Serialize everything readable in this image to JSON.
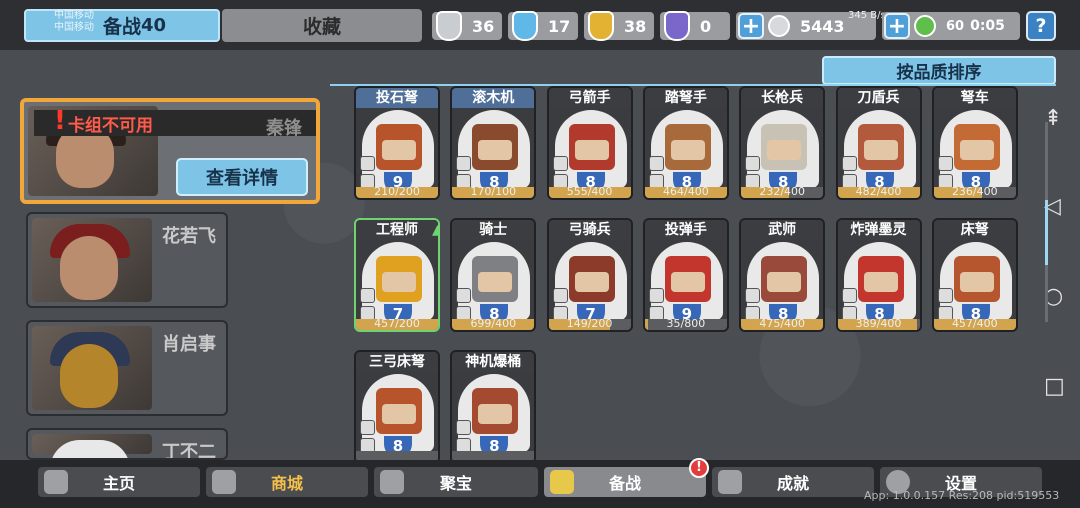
{
  "status_bar": {
    "carrier_line1": "中国移动",
    "carrier_line2": "中国移动",
    "network_speed": "345 B/s",
    "battery": "60",
    "time": "0:05"
  },
  "tabs": {
    "prepare_label": "备战",
    "prepare_count": "40",
    "collect_label": "收藏"
  },
  "resources": [
    {
      "name": "silver-shield-icon",
      "value": "36",
      "color": "#c9ccd1"
    },
    {
      "name": "blue-crystal-icon",
      "value": "17",
      "color": "#5fb8e8"
    },
    {
      "name": "gold-shield-icon",
      "value": "38",
      "color": "#e4b232"
    },
    {
      "name": "purple-shield-icon",
      "value": "0",
      "color": "#7b66c9"
    }
  ],
  "currency": {
    "value": "5443"
  },
  "sort_button": "按品质排序",
  "commanders": {
    "selected": {
      "warning": "卡组不可用",
      "name": "秦锋",
      "detail_button": "查看详情"
    },
    "list": [
      {
        "name": "花若飞"
      },
      {
        "name": "肖启事"
      },
      {
        "name": "丁不二"
      }
    ]
  },
  "units": [
    {
      "name": "投石弩",
      "level": "9",
      "progress": "210/200",
      "ratio": 1.0,
      "style": "blue",
      "color": "#b8542b"
    },
    {
      "name": "滚木机",
      "level": "8",
      "progress": "170/100",
      "ratio": 1.0,
      "style": "blue",
      "color": "#8a4a2e"
    },
    {
      "name": "弓箭手",
      "level": "8",
      "progress": "555/400",
      "ratio": 1.0,
      "style": "",
      "color": "#b23a2c"
    },
    {
      "name": "踏弩手",
      "level": "8",
      "progress": "464/400",
      "ratio": 1.0,
      "style": "",
      "color": "#a86a3a"
    },
    {
      "name": "长枪兵",
      "level": "8",
      "progress": "232/400",
      "ratio": 0.58,
      "style": "",
      "color": "#c8c2b5"
    },
    {
      "name": "刀盾兵",
      "level": "8",
      "progress": "482/400",
      "ratio": 1.0,
      "style": "",
      "color": "#b35a3c"
    },
    {
      "name": "弩车",
      "level": "8",
      "progress": "236/400",
      "ratio": 0.59,
      "style": "",
      "color": "#c46a34"
    },
    {
      "name": "工程师",
      "level": "7",
      "progress": "457/200",
      "ratio": 1.0,
      "style": "sel",
      "color": "#e0a020"
    },
    {
      "name": "骑士",
      "level": "8",
      "progress": "699/400",
      "ratio": 1.0,
      "style": "",
      "color": "#7f8084"
    },
    {
      "name": "弓骑兵",
      "level": "7",
      "progress": "149/200",
      "ratio": 0.75,
      "style": "",
      "color": "#8c3a2a"
    },
    {
      "name": "投弹手",
      "level": "9",
      "progress": "35/800",
      "ratio": 0.04,
      "style": "",
      "color": "#c2362e"
    },
    {
      "name": "武师",
      "level": "8",
      "progress": "475/400",
      "ratio": 1.0,
      "style": "",
      "color": "#9a4a3a"
    },
    {
      "name": "炸弹墨灵",
      "level": "8",
      "progress": "389/400",
      "ratio": 0.97,
      "style": "",
      "color": "#c2362e"
    },
    {
      "name": "床弩",
      "level": "8",
      "progress": "457/400",
      "ratio": 1.0,
      "style": "",
      "color": "#b5562e"
    },
    {
      "name": "三弓床弩",
      "level": "8",
      "progress": "",
      "ratio": 0,
      "style": "",
      "color": "#b8542b"
    },
    {
      "name": "神机爆桶",
      "level": "8",
      "progress": "",
      "ratio": 0,
      "style": "",
      "color": "#a34a30"
    }
  ],
  "nav": [
    {
      "label": "主页",
      "icon": "castle-icon"
    },
    {
      "label": "商城",
      "icon": "coins-icon"
    },
    {
      "label": "聚宝",
      "icon": "treasure-icon"
    },
    {
      "label": "备战",
      "icon": "card-icon",
      "badge": "!"
    },
    {
      "label": "成就",
      "icon": "achievement-icon"
    },
    {
      "label": "设置",
      "icon": "gear-icon"
    }
  ],
  "version": "App: 1.0.0.157 Res:208 pid:519553"
}
